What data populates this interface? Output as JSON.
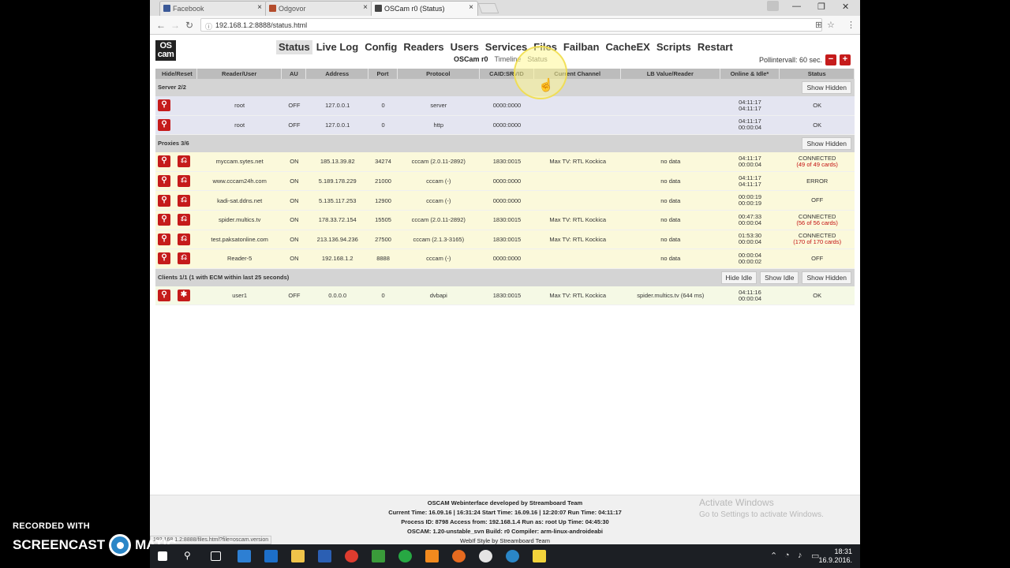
{
  "browser": {
    "tabs": [
      {
        "title": "Facebook",
        "color": "#3b5998"
      },
      {
        "title": "Odgovor",
        "color": "#b44c2c"
      },
      {
        "title": "OSCam r0 (Status)",
        "color": "#444444"
      }
    ],
    "url": "192.168.1.2:8888/status.html",
    "status_url": "192.168.1.2:8888/files.html?file=oscam.version"
  },
  "oscam": {
    "logo": "OS cam",
    "nav": [
      "Status",
      "Live Log",
      "Config",
      "Readers",
      "Users",
      "Services",
      "Files",
      "Failban",
      "CacheEX",
      "Scripts",
      "Restart"
    ],
    "subnav": {
      "current": "OSCam r0",
      "timeline": "Timeline",
      "status": "Status"
    },
    "poll_label": "Pollintervall: 60 sec.",
    "poll_minus": "−",
    "poll_plus": "+",
    "headers": [
      "Hide/Reset",
      "Reader/User",
      "AU",
      "Address",
      "Port",
      "Protocol",
      "CAID:SRVID",
      "Current Channel",
      "LB Value/Reader",
      "Online & Idle*",
      "Status"
    ],
    "server_section": {
      "title": "Server 2/2",
      "button": "Show Hidden"
    },
    "servers": [
      {
        "name": "root",
        "au": "OFF",
        "address": "127.0.0.1",
        "port": "0",
        "protocol": "server",
        "caid": "0000:0000",
        "channel": "",
        "lb": "",
        "online": "04:11:17",
        "idle": "04:11:17",
        "status": "OK"
      },
      {
        "name": "root",
        "au": "OFF",
        "address": "127.0.0.1",
        "port": "0",
        "protocol": "http",
        "caid": "0000:0000",
        "channel": "",
        "lb": "",
        "online": "04:11:17",
        "idle": "00:00:04",
        "status": "OK"
      }
    ],
    "proxy_section": {
      "title": "Proxies 3/6",
      "button": "Show Hidden"
    },
    "proxies": [
      {
        "name": "myccam.sytes.net",
        "au": "ON",
        "address": "185.13.39.82",
        "port": "34274",
        "protocol": "cccam (2.0.11-2892)",
        "caid": "1830:0015",
        "channel": "Max TV: RTL Kockica",
        "lb": "no data",
        "online": "04:11:17",
        "idle": "00:00:04",
        "status": "CONNECTED",
        "cards": "(49 of 49 cards)"
      },
      {
        "name": "www.cccam24h.com",
        "au": "ON",
        "address": "5.189.178.229",
        "port": "21000",
        "protocol": "cccam (-)",
        "caid": "0000:0000",
        "channel": "",
        "lb": "no data",
        "online": "04:11:17",
        "idle": "04:11:17",
        "status": "ERROR",
        "cards": ""
      },
      {
        "name": "kadi-sat.ddns.net",
        "au": "ON",
        "address": "5.135.117.253",
        "port": "12900",
        "protocol": "cccam (-)",
        "caid": "0000:0000",
        "channel": "",
        "lb": "no data",
        "online": "00:00:19",
        "idle": "00:00:19",
        "status": "OFF",
        "cards": ""
      },
      {
        "name": "spider.multics.tv",
        "au": "ON",
        "address": "178.33.72.154",
        "port": "15505",
        "protocol": "cccam (2.0.11-2892)",
        "caid": "1830:0015",
        "channel": "Max TV: RTL Kockica",
        "lb": "no data",
        "online": "00:47:33",
        "idle": "00:00:04",
        "status": "CONNECTED",
        "cards": "(56 of 56 cards)"
      },
      {
        "name": "test.paksatonline.com",
        "au": "ON",
        "address": "213.136.94.236",
        "port": "27500",
        "protocol": "cccam (2.1.3-3165)",
        "caid": "1830:0015",
        "channel": "Max TV: RTL Kockica",
        "lb": "no data",
        "online": "01:53:30",
        "idle": "00:00:04",
        "status": "CONNECTED",
        "cards": "(170 of 170 cards)"
      },
      {
        "name": "Reader-5",
        "au": "ON",
        "address": "192.168.1.2",
        "port": "8888",
        "protocol": "cccam (-)",
        "caid": "0000:0000",
        "channel": "",
        "lb": "no data",
        "online": "00:00:04",
        "idle": "00:00:02",
        "status": "OFF",
        "cards": ""
      }
    ],
    "client_section": {
      "title": "Clients 1/1 (1 with ECM within last 25 seconds)",
      "buttons": [
        "Hide Idle",
        "Show Idle",
        "Show Hidden"
      ]
    },
    "clients": [
      {
        "name": "user1",
        "au": "OFF",
        "address": "0.0.0.0",
        "port": "0",
        "protocol": "dvbapi",
        "caid": "1830:0015",
        "channel": "Max TV: RTL Kockica",
        "lb": "spider.multics.tv (644 ms)",
        "online": "04:11:16",
        "idle": "00:00:04",
        "status": "OK"
      }
    ],
    "footer": [
      "OSCAM Webinterface developed by Streamboard Team",
      "Current Time: 16.09.16 | 16:31:24 Start Time: 16.09.16 | 12:20:07 Run Time: 04:11:17",
      "Process ID: 8798 Access from: 192.168.1.4 Run as: root Up Time: 04:45:30",
      "OSCAM: 1.20-unstable_svn Build: r0 Compiler: arm-linux-androideabi",
      "WebIf Style by Streamboard Team"
    ]
  },
  "windows": {
    "activate_title": "Activate Windows",
    "activate_sub": "Go to Settings to activate Windows.",
    "clock_time": "18:31",
    "clock_date": "16.9.2016."
  },
  "watermark": {
    "line1": "RECORDED WITH",
    "line2a": "SCREENCAST",
    "line2b": "MATIC"
  }
}
